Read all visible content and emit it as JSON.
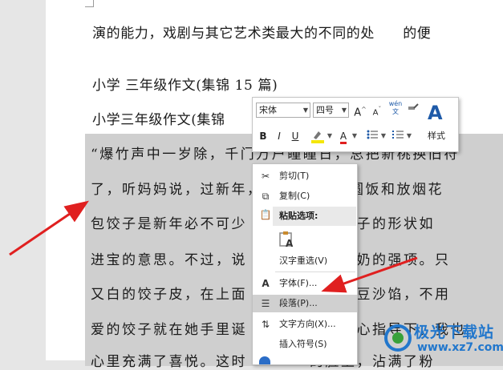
{
  "document": {
    "line1": "演的能力，戏剧与其它艺术类最大的不同的处　　的便",
    "line2": "小学 三年级作文(集锦 15 篇)",
    "line3": "小学三年级作文(集锦",
    "selected_lines": [
      "“爆竹声中一岁除，千门万户瞳瞳日，总把新桃换旧符",
      "了，听妈妈说，过新年，　　　　吃团圆饭和放烟花",
      "包饺子是新年必不可少　　　　，包饺子的形状如",
      "进宝的意思。不过，说　　　　了是奶奶的强项。只",
      "又白的饺子皮，在上面　　　　满的红豆沙馅，不用",
      "爱的饺子就在她手里诞　　　　妈的精心指导下，我也",
      "心里充满了喜悦。这时　　　　的脸上，沾满了粉"
    ]
  },
  "mini_toolbar": {
    "font_name": "宋体",
    "font_size": "四号",
    "grow_font": "A",
    "shrink_font": "A",
    "phonetic": "wén文",
    "bold": "B",
    "italic": "I",
    "underline": "U",
    "font_color_glyph": "A",
    "styles_label": "样式",
    "styles_icon": "A"
  },
  "context_menu": {
    "items": [
      {
        "label": "剪切(T)",
        "icon": "scissors-icon"
      },
      {
        "label": "复制(C)",
        "icon": "copy-icon"
      },
      {
        "label": "汉字重选(V)",
        "icon": ""
      },
      {
        "label": "字体(F)...",
        "icon": "font-icon"
      },
      {
        "label": "段落(P)...",
        "icon": "paragraph-icon"
      },
      {
        "label": "文字方向(X)...",
        "icon": "text-direction-icon"
      },
      {
        "label": "插入符号(S)",
        "icon": ""
      }
    ],
    "paste_header": "粘贴选项:",
    "highlighted": "段落(P)..."
  },
  "watermark": {
    "title": "极光下载站",
    "url": "www.xz7.com"
  },
  "colors": {
    "selection": "#cfcfcf",
    "arrow": "#e02020",
    "styles_accent": "#1e5aa8",
    "highlight": "#f4e60a",
    "font_color": "#e02020",
    "watermark": "#2277cc"
  }
}
